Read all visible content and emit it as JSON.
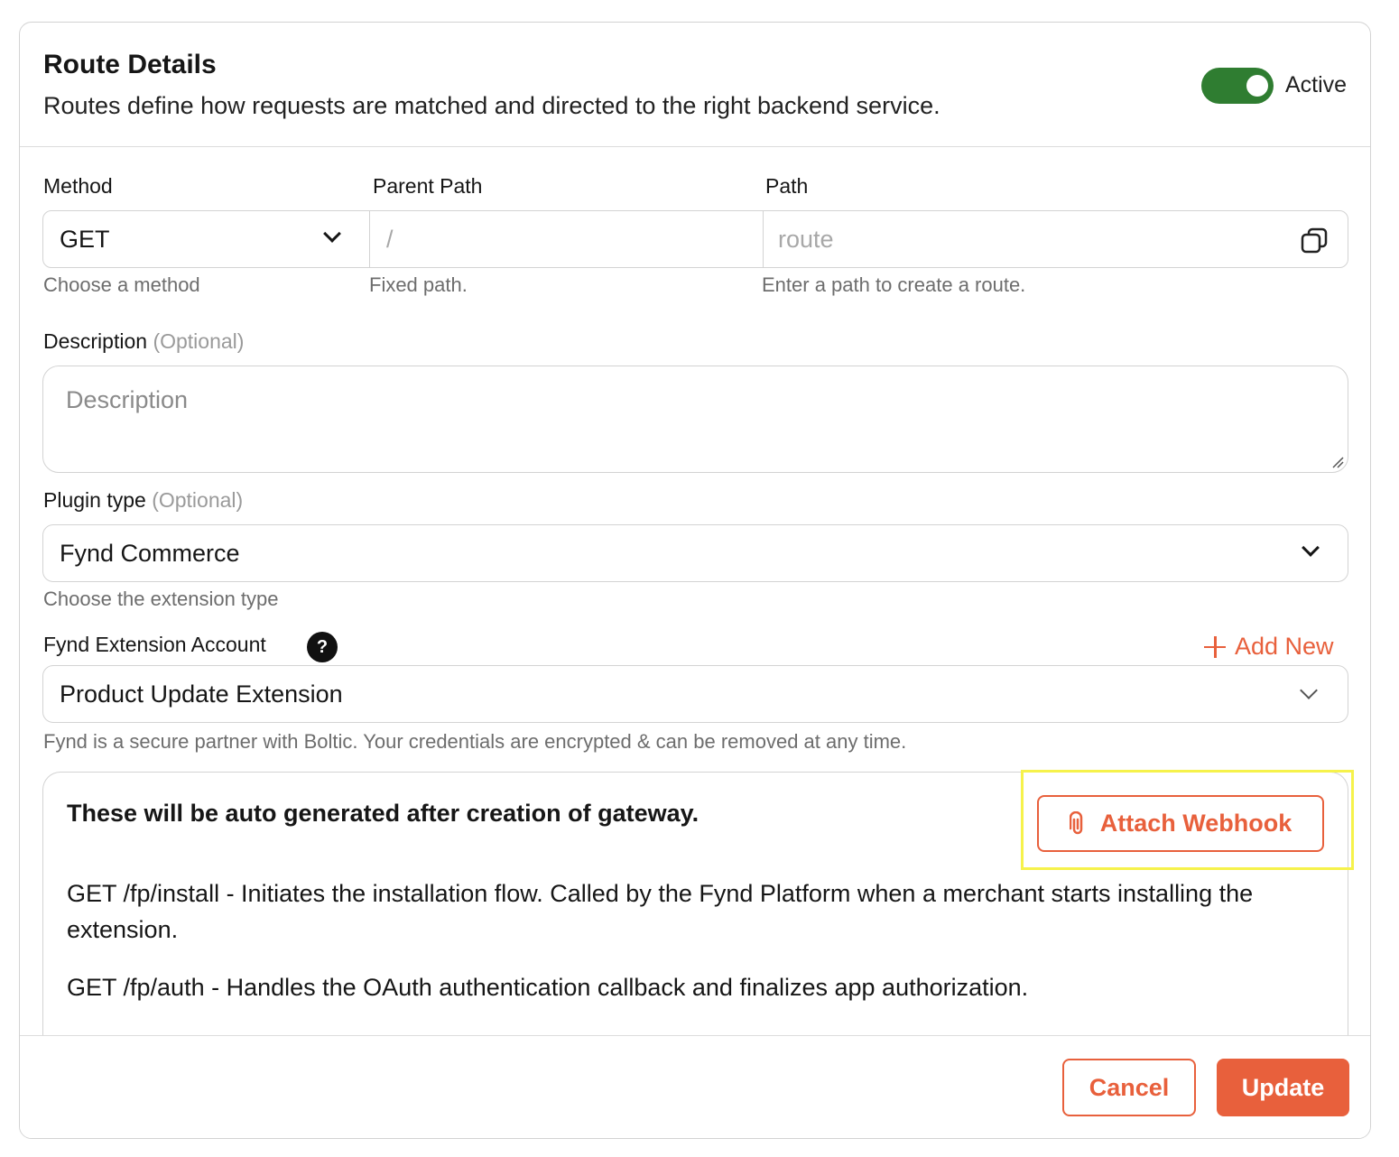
{
  "header": {
    "title": "Route Details",
    "subtitle": "Routes define how requests are matched and directed to the right backend service.",
    "toggle_label": "Active",
    "toggle_on": true,
    "toggle_color": "#2f7d31"
  },
  "route": {
    "method_label": "Method",
    "method_value": "GET",
    "method_help": "Choose a method",
    "parent_path_label": "Parent Path",
    "parent_path_value": "/",
    "parent_path_help": "Fixed path.",
    "path_label": "Path",
    "path_placeholder": "route",
    "path_help": "Enter a path to create a route.",
    "copy_icon": "copy-icon"
  },
  "description": {
    "label": "Description",
    "optional": "(Optional)",
    "placeholder": "Description"
  },
  "plugin": {
    "label": "Plugin type",
    "optional": "(Optional)",
    "value": "Fynd Commerce",
    "help": "Choose the extension type"
  },
  "extension_account": {
    "label": "Fynd Extension Account",
    "help_icon": "?",
    "add_new": "Add New",
    "value": "Product Update Extension",
    "help": "Fynd is a secure partner with Boltic. Your credentials are encrypted & can be removed at any time."
  },
  "info": {
    "title": "These will be auto generated after creation of gateway.",
    "attach_webhook": "Attach Webhook",
    "lines": [
      "GET /fp/install - Initiates the installation flow. Called by the Fynd Platform when a merchant starts installing the extension.",
      "GET /fp/auth - Handles the OAuth authentication callback and finalizes app authorization."
    ]
  },
  "footer": {
    "cancel": "Cancel",
    "update": "Update"
  },
  "colors": {
    "accent": "#e8603c",
    "highlight": "#f6f24b"
  }
}
